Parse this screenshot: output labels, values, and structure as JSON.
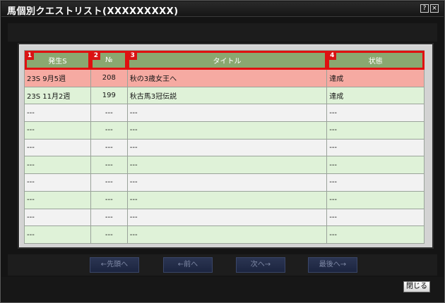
{
  "window": {
    "title": "馬個別クエストリスト(XXXXXXXXX)",
    "help_label": "?",
    "close_label": "×"
  },
  "columns": [
    {
      "marker": "1",
      "label": "発生S"
    },
    {
      "marker": "2",
      "label": "№"
    },
    {
      "marker": "3",
      "label": "タイトル"
    },
    {
      "marker": "4",
      "label": "状態"
    }
  ],
  "rows": [
    {
      "s": "23S 9月5週",
      "no": "208",
      "title": "秋の3歳女王へ",
      "status": "達成"
    },
    {
      "s": "23S 11月2週",
      "no": "199",
      "title": "秋古馬3冠伝説",
      "status": "達成"
    },
    {
      "s": "---",
      "no": "---",
      "title": "---",
      "status": "---"
    },
    {
      "s": "---",
      "no": "---",
      "title": "---",
      "status": "---"
    },
    {
      "s": "---",
      "no": "---",
      "title": "---",
      "status": "---"
    },
    {
      "s": "---",
      "no": "---",
      "title": "---",
      "status": "---"
    },
    {
      "s": "---",
      "no": "---",
      "title": "---",
      "status": "---"
    },
    {
      "s": "---",
      "no": "---",
      "title": "---",
      "status": "---"
    },
    {
      "s": "---",
      "no": "---",
      "title": "---",
      "status": "---"
    },
    {
      "s": "---",
      "no": "---",
      "title": "---",
      "status": "---"
    }
  ],
  "pagination": {
    "first_label": "←先頭へ",
    "prev_label": "←前へ",
    "next_label": "次へ→",
    "last_label": "最後へ→"
  },
  "footer": {
    "close_label": "閉じる"
  },
  "colors": {
    "header_green": "#8aa870",
    "highlight_row": "#f6aaa2",
    "green_row": "#dff2d8",
    "gray_row": "#f2f2f2",
    "marker_red": "#d81414"
  }
}
